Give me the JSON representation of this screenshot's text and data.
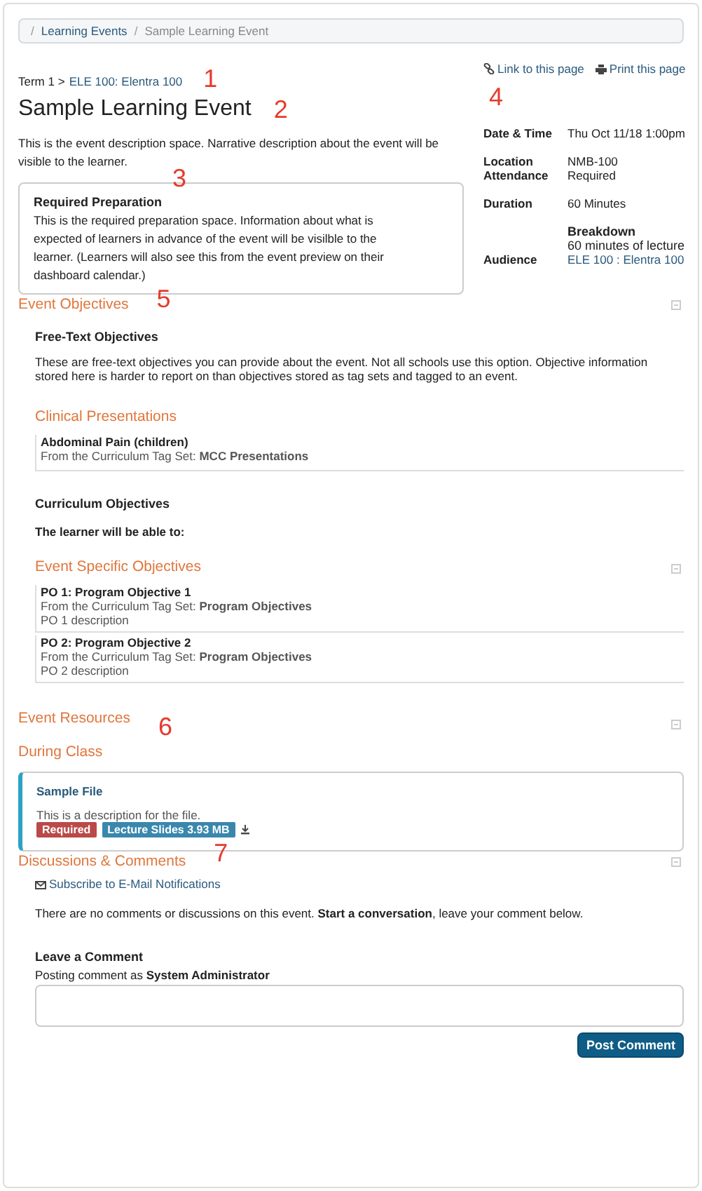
{
  "breadcrumb": [
    {
      "separator": "/",
      "label": "Learning Events",
      "kind": "link"
    },
    {
      "separator": "/",
      "label": "Sample Learning Event",
      "kind": "current"
    }
  ],
  "page_links": [
    {
      "label": "Link to this page",
      "kind": "link"
    },
    {
      "label": "Print this page",
      "kind": "print"
    }
  ],
  "term": {
    "label": "Term 1 >",
    "course": "ELE 100: Elentra 100"
  },
  "title": "Sample Learning Event",
  "description": "This is the event description space.  Narrative description about the event will be visible to the learner.",
  "required_preparation": {
    "title": "Required Preparation",
    "text": "This is the required preparation space.  Information about what is expected of learners in advance of the event will be visilble to the learner.  (Learners will also see this from the event preview on their dashboard calendar.)"
  },
  "details": [
    {
      "label": "Date & Time",
      "value": "Thu Oct 11/18 1:00pm",
      "kind": "text"
    },
    {
      "label": "Location",
      "value": "NMB-100",
      "kind": "stacked"
    },
    {
      "label": "Attendance",
      "value": "Required",
      "kind": "text"
    },
    {
      "label": "Duration",
      "value": "60 Minutes",
      "kind": "text"
    },
    {
      "heading": "Breakdown",
      "value": "60 minutes of lecture",
      "kind": "breakdown"
    },
    {
      "label": "Audience",
      "value": "ELE 100 : Elentra 100",
      "kind": "link"
    }
  ],
  "objectives": {
    "title": "Event Objectives",
    "free_text": {
      "title": "Free-Text Objectives",
      "text": "These are free-text objectives you can provide about the event.  Not all schools use this option.  Objective information stored here is harder to report on than objectives stored as tag sets and tagged to an event."
    },
    "clinical": {
      "title": "Clinical Presentations",
      "items": [
        {
          "name": "Abdominal Pain (children)",
          "source": "From the Curriculum Tag Set: **MCC Presentations**"
        }
      ]
    },
    "curriculum": {
      "title": "Curriculum Objectives",
      "intro": "The learner will be able to:"
    },
    "specific": {
      "title": "Event Specific Objectives",
      "items": [
        {
          "name": "PO 1: Program Objective 1",
          "source": "From the Curriculum Tag Set: **Program Objectives**",
          "description": "PO 1 description"
        },
        {
          "name": "PO 2: Program Objective 2",
          "source": "From the Curriculum Tag Set: **Program Objectives**",
          "description": "PO 2 description"
        }
      ]
    }
  },
  "resources": {
    "title": "Event Resources",
    "group": "During Class",
    "files": [
      {
        "name": "Sample File",
        "description": "This is a description for the file.",
        "tags": [
          {
            "label": "Required",
            "color": "#b94a48"
          },
          {
            "label": "Lecture Slides 3.93 MB",
            "color": "#3a87ad"
          }
        ]
      }
    ]
  },
  "discussions": {
    "title": "Discussions & Comments",
    "subscribe": "Subscribe to E-Mail Notifications",
    "empty": "There are no comments or discussions on this event. **Start a conversation**, leave your comment below.",
    "leave_title": "Leave a Comment",
    "posting_as": "Posting comment as **System Administrator**",
    "button": "Post Comment"
  },
  "annotations": [
    "1",
    "2",
    "3",
    "4",
    "5",
    "6",
    "7"
  ]
}
